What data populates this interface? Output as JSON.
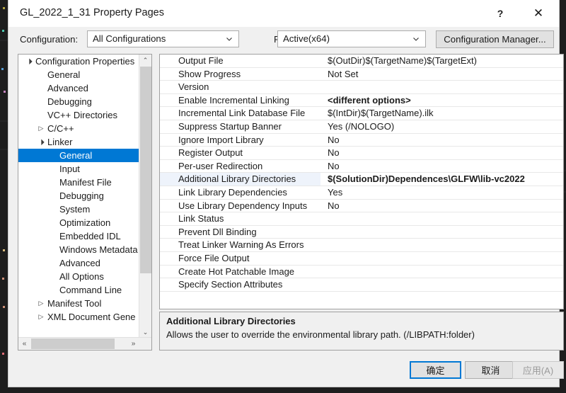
{
  "window": {
    "title": "GL_2022_1_31 Property Pages",
    "help_icon": "?",
    "close_icon": "✕"
  },
  "config_bar": {
    "configuration_label": "Configuration:",
    "configuration_value": "All Configurations",
    "platform_label": "Platform:",
    "platform_value": "Active(x64)",
    "configuration_manager_label": "Configuration Manager..."
  },
  "tree": {
    "items": [
      {
        "label": "Configuration Properties",
        "indent": 0,
        "twisty": "▲",
        "selected": false
      },
      {
        "label": "General",
        "indent": 1,
        "twisty": "",
        "selected": false
      },
      {
        "label": "Advanced",
        "indent": 1,
        "twisty": "",
        "selected": false
      },
      {
        "label": "Debugging",
        "indent": 1,
        "twisty": "",
        "selected": false
      },
      {
        "label": "VC++ Directories",
        "indent": 1,
        "twisty": "",
        "selected": false
      },
      {
        "label": "C/C++",
        "indent": 1,
        "twisty": "▷",
        "selected": false
      },
      {
        "label": "Linker",
        "indent": 1,
        "twisty": "▲",
        "selected": false
      },
      {
        "label": "General",
        "indent": 2,
        "twisty": "",
        "selected": true
      },
      {
        "label": "Input",
        "indent": 2,
        "twisty": "",
        "selected": false
      },
      {
        "label": "Manifest File",
        "indent": 2,
        "twisty": "",
        "selected": false
      },
      {
        "label": "Debugging",
        "indent": 2,
        "twisty": "",
        "selected": false
      },
      {
        "label": "System",
        "indent": 2,
        "twisty": "",
        "selected": false
      },
      {
        "label": "Optimization",
        "indent": 2,
        "twisty": "",
        "selected": false
      },
      {
        "label": "Embedded IDL",
        "indent": 2,
        "twisty": "",
        "selected": false
      },
      {
        "label": "Windows Metadata",
        "indent": 2,
        "twisty": "",
        "selected": false
      },
      {
        "label": "Advanced",
        "indent": 2,
        "twisty": "",
        "selected": false
      },
      {
        "label": "All Options",
        "indent": 2,
        "twisty": "",
        "selected": false
      },
      {
        "label": "Command Line",
        "indent": 2,
        "twisty": "",
        "selected": false
      },
      {
        "label": "Manifest Tool",
        "indent": 1,
        "twisty": "▷",
        "selected": false
      },
      {
        "label": "XML Document Gene",
        "indent": 1,
        "twisty": "▷",
        "selected": false
      }
    ],
    "scroll_up_icon": "⌃",
    "scroll_down_icon": "⌄",
    "scroll_left_icon": "«",
    "scroll_right_icon": "»"
  },
  "grid": {
    "rows": [
      {
        "name": "Output File",
        "value": "$(OutDir)$(TargetName)$(TargetExt)",
        "bold": false,
        "highlight": false
      },
      {
        "name": "Show Progress",
        "value": "Not Set",
        "bold": false,
        "highlight": false
      },
      {
        "name": "Version",
        "value": "",
        "bold": false,
        "highlight": false
      },
      {
        "name": "Enable Incremental Linking",
        "value": "<different options>",
        "bold": true,
        "highlight": false
      },
      {
        "name": "Incremental Link Database File",
        "value": "$(IntDir)$(TargetName).ilk",
        "bold": false,
        "highlight": false
      },
      {
        "name": "Suppress Startup Banner",
        "value": "Yes (/NOLOGO)",
        "bold": false,
        "highlight": false
      },
      {
        "name": "Ignore Import Library",
        "value": "No",
        "bold": false,
        "highlight": false
      },
      {
        "name": "Register Output",
        "value": "No",
        "bold": false,
        "highlight": false
      },
      {
        "name": "Per-user Redirection",
        "value": "No",
        "bold": false,
        "highlight": false
      },
      {
        "name": "Additional Library Directories",
        "value": "$(SolutionDir)Dependences\\GLFW\\lib-vc2022",
        "bold": true,
        "highlight": true
      },
      {
        "name": "Link Library Dependencies",
        "value": "Yes",
        "bold": false,
        "highlight": false
      },
      {
        "name": "Use Library Dependency Inputs",
        "value": "No",
        "bold": false,
        "highlight": false
      },
      {
        "name": "Link Status",
        "value": "",
        "bold": false,
        "highlight": false
      },
      {
        "name": "Prevent Dll Binding",
        "value": "",
        "bold": false,
        "highlight": false
      },
      {
        "name": "Treat Linker Warning As Errors",
        "value": "",
        "bold": false,
        "highlight": false
      },
      {
        "name": "Force File Output",
        "value": "",
        "bold": false,
        "highlight": false
      },
      {
        "name": "Create Hot Patchable Image",
        "value": "",
        "bold": false,
        "highlight": false
      },
      {
        "name": "Specify Section Attributes",
        "value": "",
        "bold": false,
        "highlight": false
      }
    ]
  },
  "description": {
    "title": "Additional Library Directories",
    "body": "Allows the user to override the environmental library path. (/LIBPATH:folder)"
  },
  "footer": {
    "ok_label": "确定",
    "cancel_label": "取消",
    "apply_label": "应用(A)"
  },
  "colors": {
    "accent": "#0078d4",
    "dialog_bg": "#f0f0f0",
    "highlight_row": "#eef3fb",
    "backdrop": "#1e1e1e"
  }
}
